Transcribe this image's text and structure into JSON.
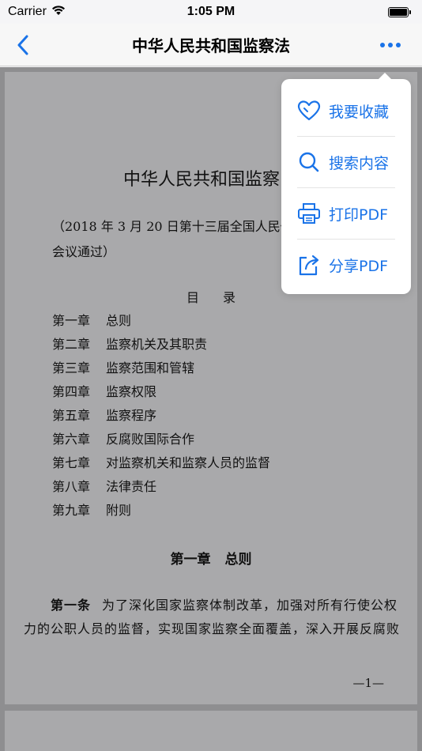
{
  "status_bar": {
    "carrier": "Carrier",
    "time": "1:05 PM"
  },
  "nav": {
    "title": "中华人民共和国监察法"
  },
  "document": {
    "title": "中华人民共和国监察",
    "subtitle": "（2018 年 3 月 20 日第十三届全国人民代\n会议通过）",
    "toc_heading": "目录",
    "toc": [
      {
        "chapter": "第一章",
        "title": "总则"
      },
      {
        "chapter": "第二章",
        "title": "监察机关及其职责"
      },
      {
        "chapter": "第三章",
        "title": "监察范围和管辖"
      },
      {
        "chapter": "第四章",
        "title": "监察权限"
      },
      {
        "chapter": "第五章",
        "title": "监察程序"
      },
      {
        "chapter": "第六章",
        "title": "反腐败国际合作"
      },
      {
        "chapter": "第七章",
        "title": "对监察机关和监察人员的监督"
      },
      {
        "chapter": "第八章",
        "title": "法律责任"
      },
      {
        "chapter": "第九章",
        "title": "附则"
      }
    ],
    "chapter_heading": "第一章 总则",
    "article_number": "第一条",
    "article_text": "为了深化国家监察体制改革，加强对所有行使公权力的公职人员的监督，实现国家监察全面覆盖，深入开展反腐败",
    "page_number": "—1—"
  },
  "menu": {
    "items": [
      {
        "label": "我要收藏",
        "icon": "heart-icon"
      },
      {
        "label": "搜索内容",
        "icon": "search-icon"
      },
      {
        "label": "打印PDF",
        "icon": "printer-icon"
      },
      {
        "label": "分享PDF",
        "icon": "share-icon"
      }
    ]
  },
  "colors": {
    "accent": "#1a73e8",
    "overlay_dim": "#8e8e90"
  }
}
